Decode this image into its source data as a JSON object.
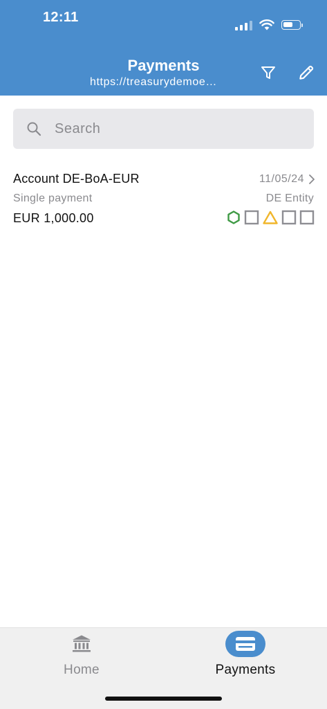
{
  "status_bar": {
    "time": "12:11"
  },
  "header": {
    "title": "Payments",
    "subtitle": "https://treasurydemoe…",
    "filter_icon": "filter-icon",
    "edit_icon": "pencil-icon",
    "background": "#4a8dcd"
  },
  "search": {
    "placeholder": "Search",
    "value": ""
  },
  "payments": [
    {
      "account": "Account DE-BoA-EUR",
      "date": "11/05/24",
      "type": "Single payment",
      "entity": "DE Entity",
      "amount": "EUR 1,000.00",
      "status_icons": [
        {
          "shape": "hexagon",
          "color": "#3f9a45"
        },
        {
          "shape": "square",
          "color": "#8e8e93"
        },
        {
          "shape": "triangle",
          "color": "#f0b62c"
        },
        {
          "shape": "square",
          "color": "#8e8e93"
        },
        {
          "shape": "square",
          "color": "#8e8e93"
        }
      ]
    }
  ],
  "tabbar": {
    "tabs": [
      {
        "label": "Home",
        "icon": "bank-icon",
        "active": false
      },
      {
        "label": "Payments",
        "icon": "credit-card-icon",
        "active": true
      }
    ]
  },
  "colors": {
    "accent": "#4a8dcd",
    "success": "#3f9a45",
    "warning": "#f0b62c",
    "neutral": "#8e8e93"
  }
}
